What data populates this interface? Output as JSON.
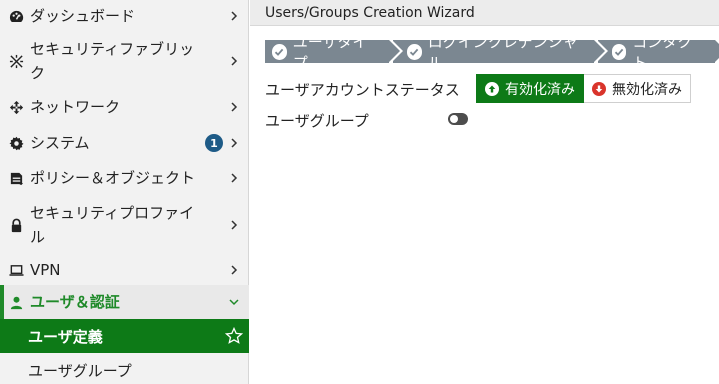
{
  "sidebar": {
    "items": [
      {
        "label": "ダッシュボード",
        "icon": "dashboard-icon"
      },
      {
        "label": "セキュリティファブリック",
        "icon": "fabric-icon"
      },
      {
        "label": "ネットワーク",
        "icon": "network-icon"
      },
      {
        "label": "システム",
        "icon": "gear-icon",
        "badge": "1"
      },
      {
        "label": "ポリシー＆オブジェクト",
        "icon": "policy-icon"
      },
      {
        "label": "セキュリティプロファイル",
        "icon": "lock-icon"
      },
      {
        "label": "VPN",
        "icon": "laptop-icon"
      },
      {
        "label": "ユーザ＆認証",
        "icon": "user-icon"
      }
    ],
    "sub_items": [
      {
        "label": "ユーザ定義"
      },
      {
        "label": "ユーザグループ"
      }
    ]
  },
  "main": {
    "title": "Users/Groups Creation Wizard",
    "steps": [
      {
        "label": "ユーザタイプ"
      },
      {
        "label": "ログインクレデンシャル"
      },
      {
        "label": "コンタクト"
      }
    ],
    "status_label": "ユーザアカウントステータス",
    "enabled_label": "有効化済み",
    "disabled_label": "無効化済み",
    "group_label": "ユーザグループ"
  },
  "colors": {
    "accent_green": "#0d7a17",
    "step_gray": "#7b8791",
    "badge_blue": "#1e5b87",
    "disable_red": "#d9342b"
  }
}
